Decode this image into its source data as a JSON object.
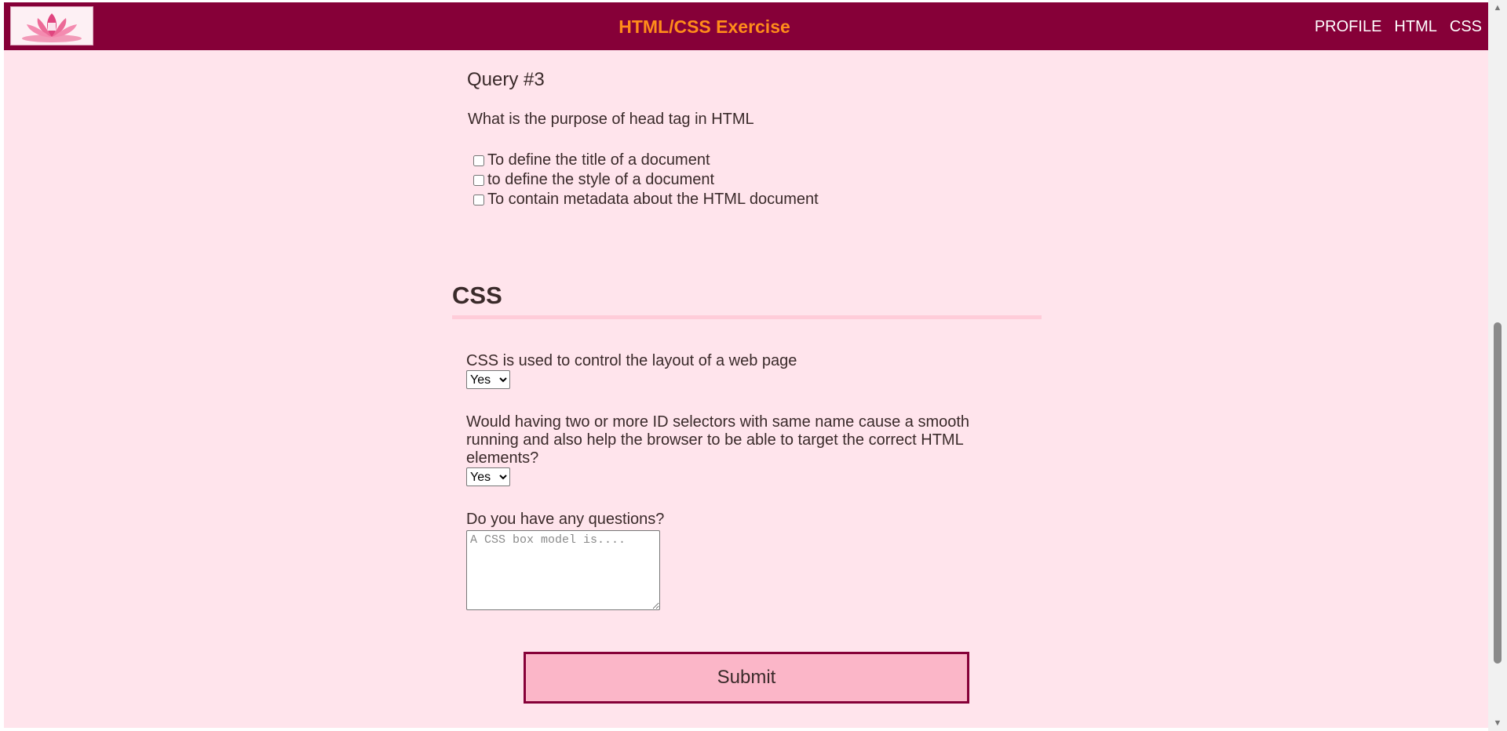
{
  "header": {
    "site_title": "HTML/CSS Exercise",
    "nav": [
      "PROFILE",
      "HTML",
      "CSS"
    ],
    "logo_icon": "lotus-logo-icon",
    "background_color": "#860038",
    "title_color": "#ff8c1a"
  },
  "query3": {
    "title": "Query #3",
    "question": "What is the purpose of head tag in HTML",
    "options": [
      "To define the title of a document",
      "to define the style of a document",
      "To contain metadata about the HTML document"
    ]
  },
  "css_section": {
    "title": "CSS",
    "q1": {
      "label": "CSS is used to control the layout of a web page",
      "selected": "Yes"
    },
    "q2": {
      "label": "Would having two or more ID selectors with same name cause a smooth running and also help the browser to be able to target the correct HTML elements?",
      "selected": "Yes"
    },
    "q3": {
      "label": "Do you have any questions?",
      "placeholder": "A CSS box model is...."
    }
  },
  "submit_label": "Submit",
  "colors": {
    "page_background": "#ffe4ec",
    "accent": "#860038",
    "submit_background": "#fbb6c8"
  }
}
